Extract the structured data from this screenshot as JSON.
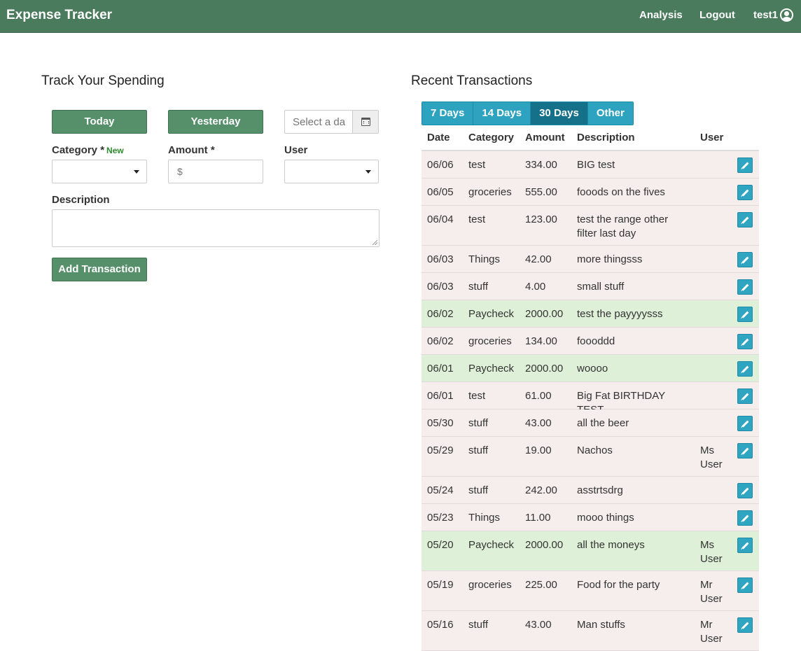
{
  "navbar": {
    "brand": "Expense Tracker",
    "links": [
      "Analysis",
      "Logout"
    ],
    "username": "test1"
  },
  "form": {
    "title": "Track Your Spending",
    "today_label": "Today",
    "yesterday_label": "Yesterday",
    "date_placeholder": "Select a da",
    "category_label": "Category",
    "required_mark": "*",
    "new_label": "New",
    "amount_label": "Amount",
    "amount_placeholder": "$",
    "user_label": "User",
    "description_label": "Description",
    "submit_label": "Add Transaction"
  },
  "transactions": {
    "title": "Recent Transactions",
    "tabs": [
      {
        "label": "7 Days",
        "active": false
      },
      {
        "label": "14 Days",
        "active": false
      },
      {
        "label": "30 Days",
        "active": true
      },
      {
        "label": "Other",
        "active": false
      }
    ],
    "columns": [
      "Date",
      "Category",
      "Amount",
      "Description",
      "User"
    ],
    "rows": [
      {
        "date": "06/06",
        "category": "test",
        "amount": "334.00",
        "description": "BIG test",
        "user": "",
        "type": "expense"
      },
      {
        "date": "06/05",
        "category": "groceries",
        "amount": "555.00",
        "description": "fooods on the fives",
        "user": "",
        "type": "expense"
      },
      {
        "date": "06/04",
        "category": "test",
        "amount": "123.00",
        "description": "test the range other filter last day",
        "user": "",
        "type": "expense"
      },
      {
        "date": "06/03",
        "category": "Things",
        "amount": "42.00",
        "description": "more thingsss",
        "user": "",
        "type": "expense"
      },
      {
        "date": "06/03",
        "category": "stuff",
        "amount": "4.00",
        "description": "small stuff",
        "user": "",
        "type": "expense"
      },
      {
        "date": "06/02",
        "category": "Paycheck",
        "amount": "2000.00",
        "description": "test the payyyysss",
        "user": "",
        "type": "income"
      },
      {
        "date": "06/02",
        "category": "groceries",
        "amount": "134.00",
        "description": "foooddd",
        "user": "",
        "type": "expense"
      },
      {
        "date": "06/01",
        "category": "Paycheck",
        "amount": "2000.00",
        "description": "woooo",
        "user": "",
        "type": "income"
      },
      {
        "date": "06/01",
        "category": "test",
        "amount": "61.00",
        "description": "Big Fat BIRTHDAY TEST",
        "user": "",
        "type": "expense"
      },
      {
        "date": "05/30",
        "category": "stuff",
        "amount": "43.00",
        "description": "all the beer",
        "user": "",
        "type": "expense"
      },
      {
        "date": "05/29",
        "category": "stuff",
        "amount": "19.00",
        "description": "Nachos",
        "user": "Ms User",
        "type": "expense"
      },
      {
        "date": "05/24",
        "category": "stuff",
        "amount": "242.00",
        "description": "asstrtsdrg",
        "user": "",
        "type": "expense"
      },
      {
        "date": "05/23",
        "category": "Things",
        "amount": "11.00",
        "description": "mooo things",
        "user": "",
        "type": "expense"
      },
      {
        "date": "05/20",
        "category": "Paycheck",
        "amount": "2000.00",
        "description": "all the moneys",
        "user": "Ms User",
        "type": "income"
      },
      {
        "date": "05/19",
        "category": "groceries",
        "amount": "225.00",
        "description": "Food for the party",
        "user": "Mr User",
        "type": "expense"
      },
      {
        "date": "05/16",
        "category": "stuff",
        "amount": "43.00",
        "description": "Man stuffs",
        "user": "Mr User",
        "type": "expense"
      }
    ]
  },
  "colors": {
    "navbar": "#4a7b5c",
    "primary_button": "#56906a",
    "tab": "#2ea3c0",
    "tab_active": "#15708a",
    "expense_row": "#f6eded",
    "income_row": "#dff0d8",
    "new_link": "#2e8a2e"
  },
  "icons": {
    "calendar": "calendar-icon",
    "user": "user-circle-icon",
    "edit": "pencil-icon",
    "dropdown": "caret-down-icon"
  }
}
